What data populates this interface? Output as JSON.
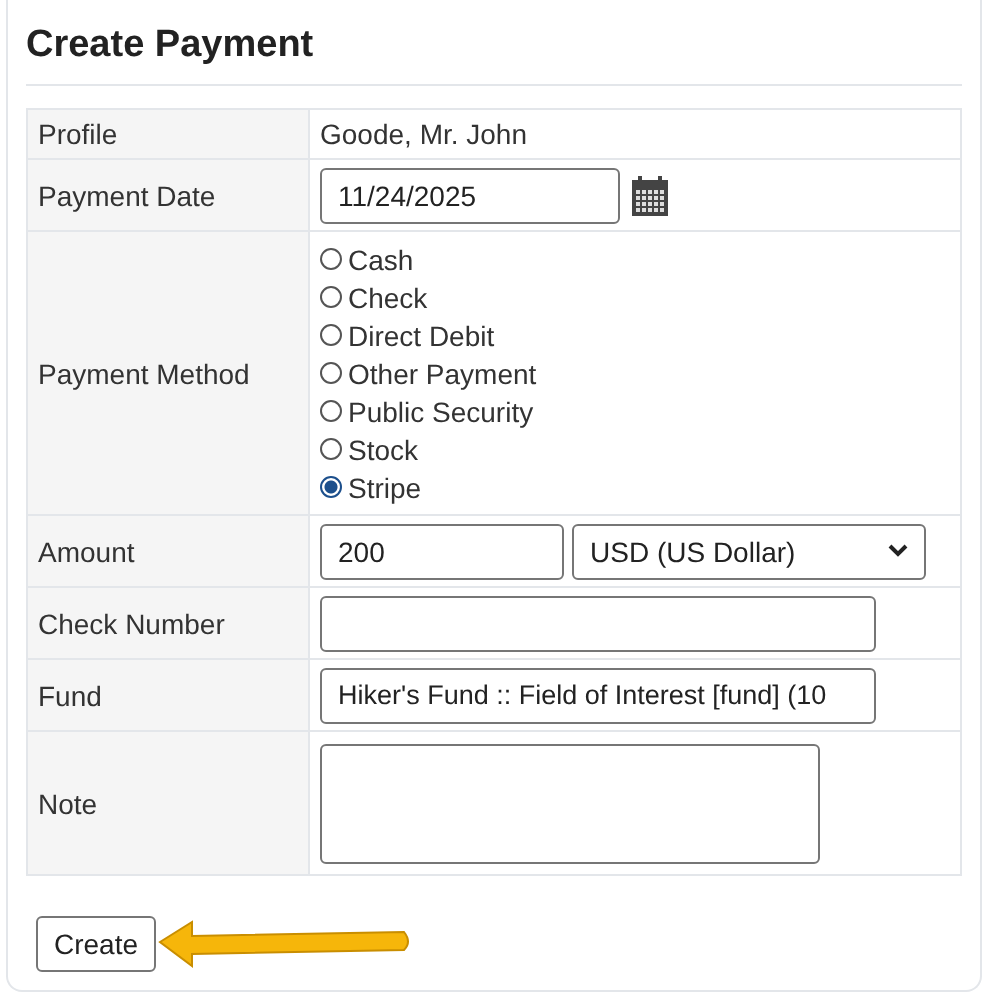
{
  "title": "Create Payment",
  "rows": [
    {
      "kind": "text",
      "label": "Profile",
      "value": "Goode, Mr. John"
    },
    {
      "kind": "date",
      "label": "Payment Date",
      "value": "11/24/2025"
    },
    {
      "kind": "radio",
      "label": "Payment Method",
      "options": [
        {
          "label": "Cash",
          "selected": false
        },
        {
          "label": "Check",
          "selected": false
        },
        {
          "label": "Direct Debit",
          "selected": false
        },
        {
          "label": "Other Payment",
          "selected": false
        },
        {
          "label": "Public Security",
          "selected": false
        },
        {
          "label": "Stock",
          "selected": false
        },
        {
          "label": "Stripe",
          "selected": true
        }
      ]
    },
    {
      "kind": "amount",
      "label": "Amount",
      "value": "200",
      "currency": "USD (US Dollar)"
    },
    {
      "kind": "input",
      "label": "Check Number"
    },
    {
      "kind": "input",
      "label": "Fund",
      "value": "Hiker's Fund :: Field of Interest [fund] (10"
    },
    {
      "kind": "textarea",
      "label": "Note"
    }
  ],
  "button": "Create"
}
